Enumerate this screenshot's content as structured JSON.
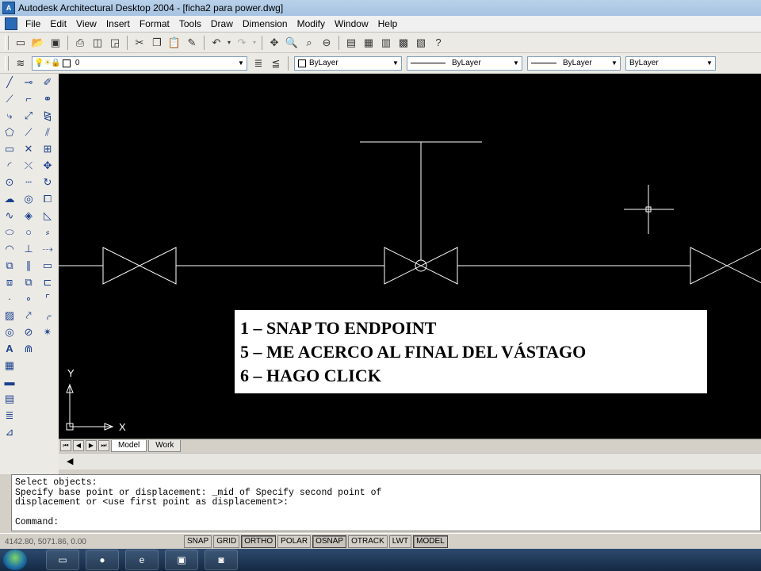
{
  "window": {
    "title": "Autodesk Architectural Desktop 2004 - [ficha2 para power.dwg]"
  },
  "menu": [
    "File",
    "Edit",
    "View",
    "Insert",
    "Format",
    "Tools",
    "Draw",
    "Dimension",
    "Modify",
    "Window",
    "Help"
  ],
  "layers": {
    "current_layer": "0",
    "color": "ByLayer",
    "linetype": "ByLayer",
    "lineweight": "ByLayer",
    "plotstyle": "ByLayer"
  },
  "tabs": {
    "model": "Model",
    "work": "Work"
  },
  "ucs": {
    "x_label": "X",
    "y_label": "Y"
  },
  "overlay": {
    "line1": "1 – SNAP TO ENDPOINT",
    "line2": "5 – ME ACERCO AL FINAL DEL VÁSTAGO",
    "line3": "6 – HAGO CLICK"
  },
  "command": {
    "lines": [
      "Select objects:",
      "Specify base point or displacement: _mid of Specify second point of",
      "displacement or <use first point as displacement>:",
      "",
      "Command:"
    ]
  },
  "status": {
    "coords": "4142.80, 5071.86, 0.00",
    "buttons": [
      "SNAP",
      "GRID",
      "ORTHO",
      "POLAR",
      "OSNAP",
      "OTRACK",
      "LWT",
      "MODEL"
    ]
  },
  "colors": {
    "canvas": "#000000",
    "lines": "#ffffff"
  }
}
